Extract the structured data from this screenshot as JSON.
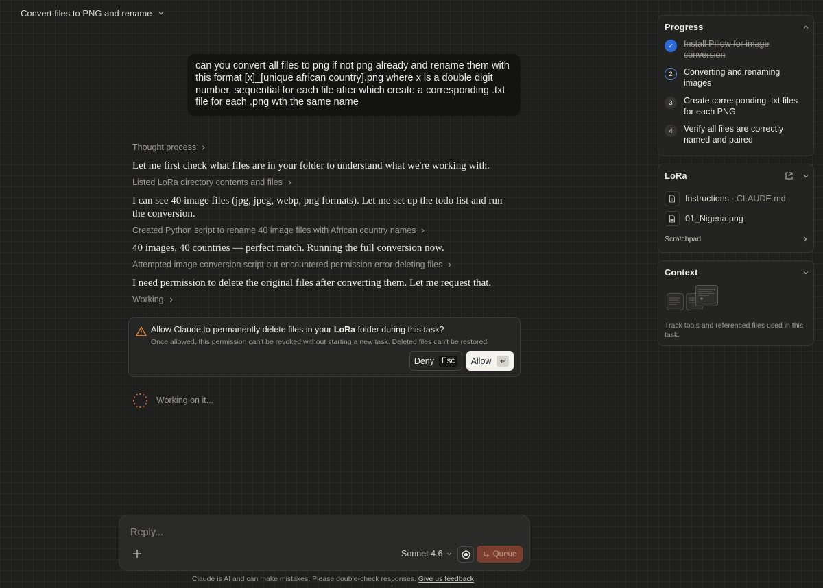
{
  "header": {
    "title": "Convert files to PNG and rename"
  },
  "user_message": "can you convert all files to png if not png already and rename them with this format  [x]_[unique african country].png where x is a double digit number, sequential for each file after which create a corresponding .txt file for each .png wth the same name",
  "transcript": {
    "step1": "Thought process",
    "reply1": "Let me first check what files are in your folder to understand what we're working with.",
    "step2": "Listed LoRa directory contents and files",
    "reply2": "I can see 40 image files (jpg, jpeg, webp, png formats). Let me set up the todo list and run the conversion.",
    "step3": "Created Python script to rename 40 image files with African country names",
    "reply3": "40 images, 40 countries — perfect match. Running the full conversion now.",
    "step4": "Attempted image conversion script but encountered permission error deleting files",
    "reply4": "I need permission to delete the original files after converting them. Let me request that.",
    "step5": "Working"
  },
  "permission": {
    "title_pre": "Allow Claude to permanently delete files in your ",
    "folder": "LoRa",
    "title_post": " folder during this task?",
    "subtitle": "Once allowed, this permission can't be revoked without starting a new task. Deleted files can't be restored.",
    "deny_label": "Deny",
    "deny_key": "Esc",
    "allow_label": "Allow"
  },
  "status": {
    "working": "Working on it..."
  },
  "composer": {
    "placeholder": "Reply...",
    "model": "Sonnet 4.6",
    "queue_label": "Queue"
  },
  "disclaimer": {
    "text": "Claude is AI and can make mistakes. Please double-check responses. ",
    "link": "Give us feedback"
  },
  "progress": {
    "title": "Progress",
    "items": [
      {
        "badge": "✓",
        "label": "Install Pillow for image conversion",
        "state": "done"
      },
      {
        "badge": "2",
        "label": "Converting and renaming images",
        "state": "active"
      },
      {
        "badge": "3",
        "label": "Create corresponding .txt files for each PNG",
        "state": "pending"
      },
      {
        "badge": "4",
        "label": "Verify all files are correctly named and paired",
        "state": "pending"
      }
    ]
  },
  "lora": {
    "title": "LoRa",
    "files": [
      {
        "name": "Instructions",
        "sep": " · ",
        "detail": "CLAUDE.md",
        "icon": "document-icon"
      },
      {
        "name": "01_Nigeria.png",
        "icon": "png-file-icon"
      }
    ],
    "scratchpad": "Scratchpad"
  },
  "context": {
    "title": "Context",
    "description": "Track tools and referenced files used in this task."
  },
  "colors": {
    "background": "#1f1f1e",
    "accent_queue": "#7a3f30",
    "done_check": "#2f6bd8",
    "warning": "#e08a3c"
  }
}
